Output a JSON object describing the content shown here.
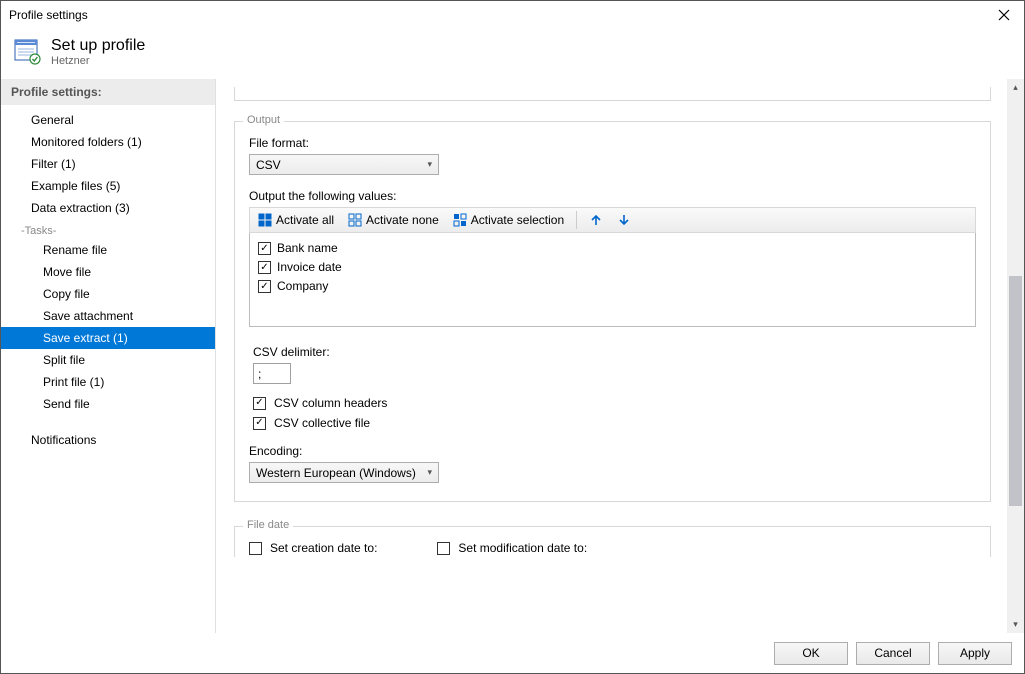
{
  "window_title": "Profile settings",
  "header": {
    "title": "Set up profile",
    "subtitle": "Hetzner"
  },
  "sidebar": {
    "heading": "Profile settings:",
    "items": [
      "General",
      "Monitored folders (1)",
      "Filter (1)",
      "Example files (5)",
      "Data extraction (3)"
    ],
    "tasks_label": "-Tasks-",
    "tasks": [
      "Rename file",
      "Move file",
      "Copy file",
      "Save attachment",
      "Save extract (1)",
      "Split file",
      "Print file (1)",
      "Send file"
    ],
    "selected_task_index": 4,
    "notifications": "Notifications"
  },
  "output": {
    "legend": "Output",
    "file_format_label": "File format:",
    "file_format_value": "CSV",
    "values_label": "Output the following values:",
    "toolbar": {
      "activate_all": "Activate all",
      "activate_none": "Activate none",
      "activate_selection": "Activate selection"
    },
    "values_list": [
      {
        "checked": true,
        "label": "Bank name"
      },
      {
        "checked": true,
        "label": "Invoice date"
      },
      {
        "checked": true,
        "label": "Company"
      }
    ],
    "csv_delim_label": "CSV delimiter:",
    "csv_delim_value": ";",
    "csv_headers": {
      "checked": true,
      "label": "CSV column headers"
    },
    "csv_collective": {
      "checked": true,
      "label": "CSV collective file"
    },
    "encoding_label": "Encoding:",
    "encoding_value": "Western European (Windows)"
  },
  "file_date": {
    "legend": "File date",
    "set_creation": {
      "checked": false,
      "label": "Set creation date to:"
    },
    "set_modification": {
      "checked": false,
      "label": "Set modification date to:"
    }
  },
  "buttons": {
    "ok": "OK",
    "cancel": "Cancel",
    "apply": "Apply"
  }
}
